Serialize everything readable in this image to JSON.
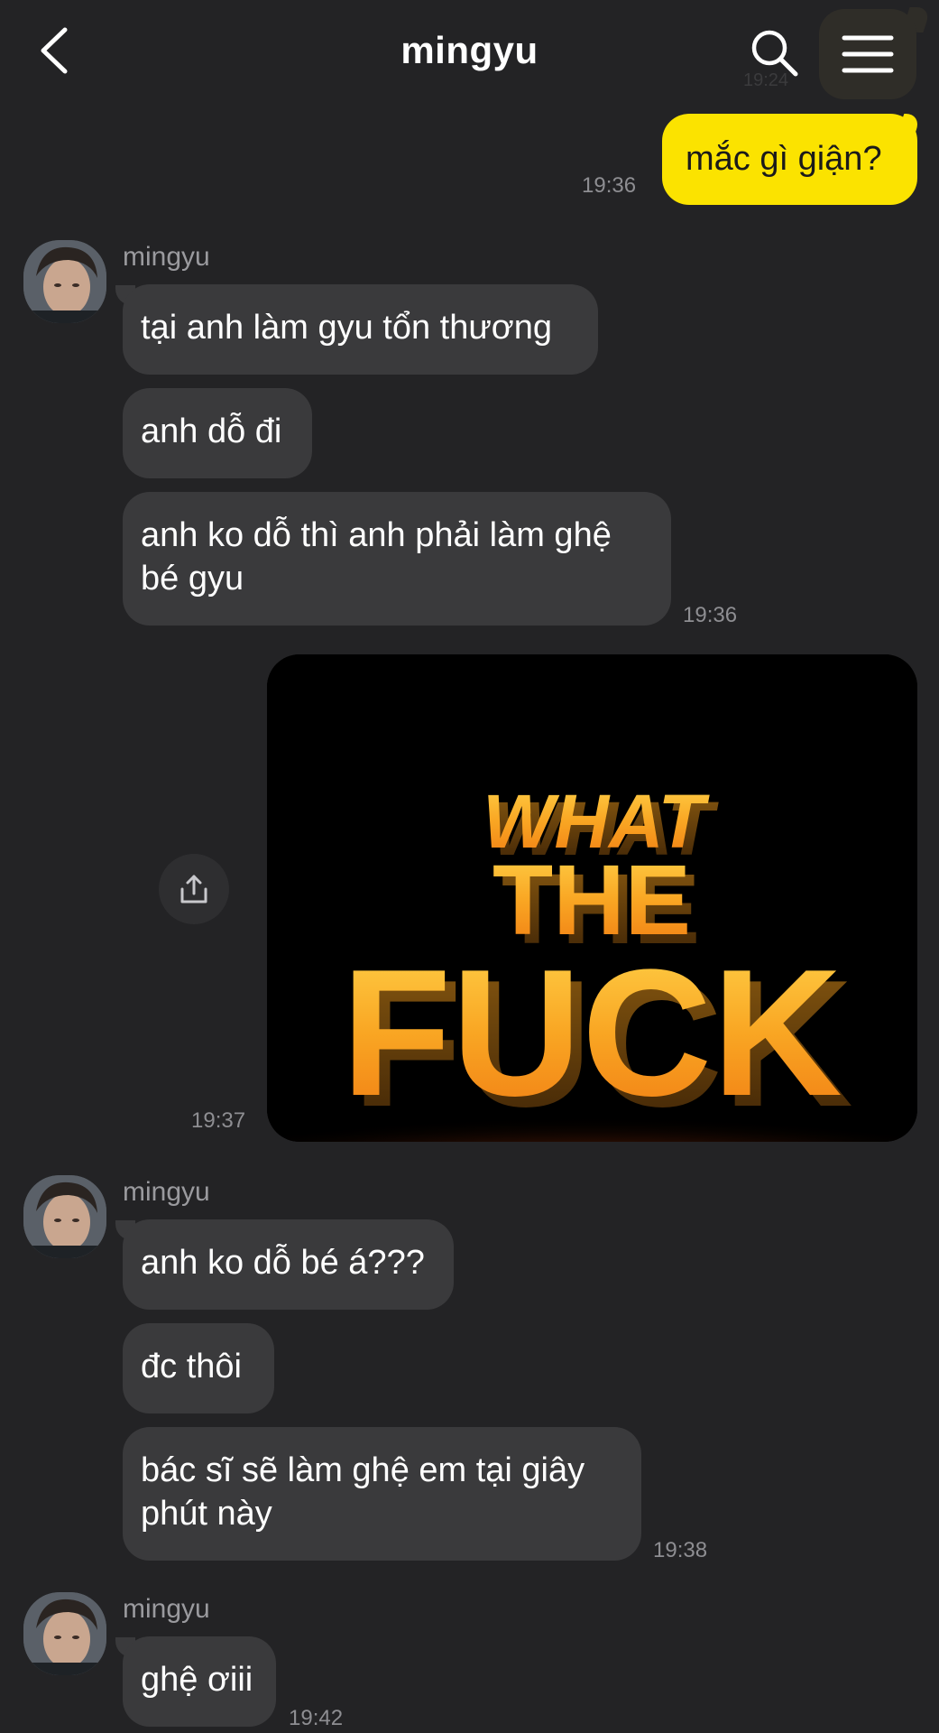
{
  "header": {
    "title": "mingyu",
    "ghost_time": "19:24",
    "back_icon": "chevron-left-icon",
    "search_icon": "search-icon",
    "menu_icon": "hamburger-menu-icon"
  },
  "colors": {
    "background": "#232325",
    "incoming_bubble": "#3a3a3c",
    "outgoing_bubble": "#fbe300"
  },
  "messages": [
    {
      "from": "me",
      "text": "mắc gì giận?",
      "time": "19:36"
    },
    {
      "from": "mingyu",
      "sender": "mingyu",
      "text": "tại anh làm gyu tổn thương"
    },
    {
      "from": "mingyu",
      "text": "anh dỗ đi"
    },
    {
      "from": "mingyu",
      "text": "anh ko dỗ thì anh phải làm ghệ bé gyu",
      "time": "19:36"
    },
    {
      "from": "me",
      "type": "image",
      "image_text": [
        "WHAT",
        "THE",
        "FUCK"
      ],
      "time": "19:37",
      "share_icon": "share-icon"
    },
    {
      "from": "mingyu",
      "sender": "mingyu",
      "text": "anh ko dỗ bé á???"
    },
    {
      "from": "mingyu",
      "text": "đc thôi"
    },
    {
      "from": "mingyu",
      "text": "bác sĩ sẽ làm ghệ em tại giây phút này",
      "time": "19:38"
    },
    {
      "from": "mingyu",
      "sender": "mingyu",
      "text": "ghệ ơiii",
      "time": "19:42"
    }
  ]
}
